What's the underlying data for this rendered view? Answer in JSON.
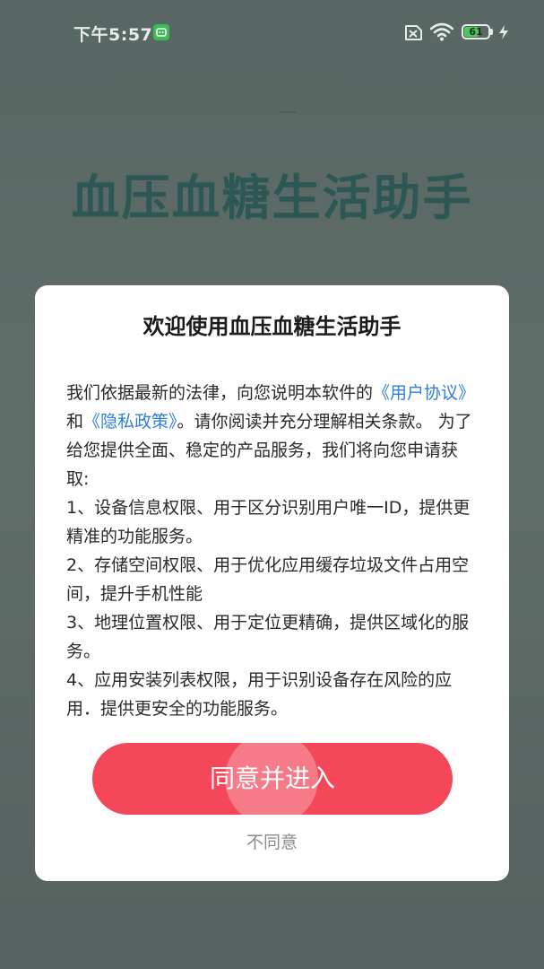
{
  "status_bar": {
    "time": "下午5:57",
    "battery_level": "61",
    "battery_percent": 61,
    "icons": [
      "notification-app-icon",
      "no-sim-icon",
      "wifi-icon",
      "battery-icon",
      "charging-icon"
    ]
  },
  "background": {
    "app_title": "血压血糖生活助手"
  },
  "dialog": {
    "title": "欢迎使用血压血糖生活助手",
    "intro_before": "我们依据最新的法律，向您说明本软件的",
    "user_agreement_link": "《用户协议》",
    "and": "和",
    "privacy_policy_link": "《隐私政策》",
    "intro_after": "。请你阅读并充分理解相关条款。 为了给您提供全面、稳定的产品服务，我们将向您申请获取:",
    "items": [
      "1、设备信息权限、用于区分识别用户唯一ID，提供更精准的功能服务。",
      "2、存储空间权限、用于优化应用缓存垃圾文件占用空间，提升手机性能",
      "3、地理位置权限、用于定位更精确，提供区域化的服务。",
      "4、应用安装列表权限，用于识别设备存在风险的应用．提供更安全的功能服务。"
    ],
    "agree_label": "同意并进入",
    "disagree_label": "不同意"
  },
  "colors": {
    "accent": "#f4475a",
    "link": "#2f7fd6",
    "background_overlay": "#5c6a66",
    "title_bg_text": "#2c5754"
  }
}
